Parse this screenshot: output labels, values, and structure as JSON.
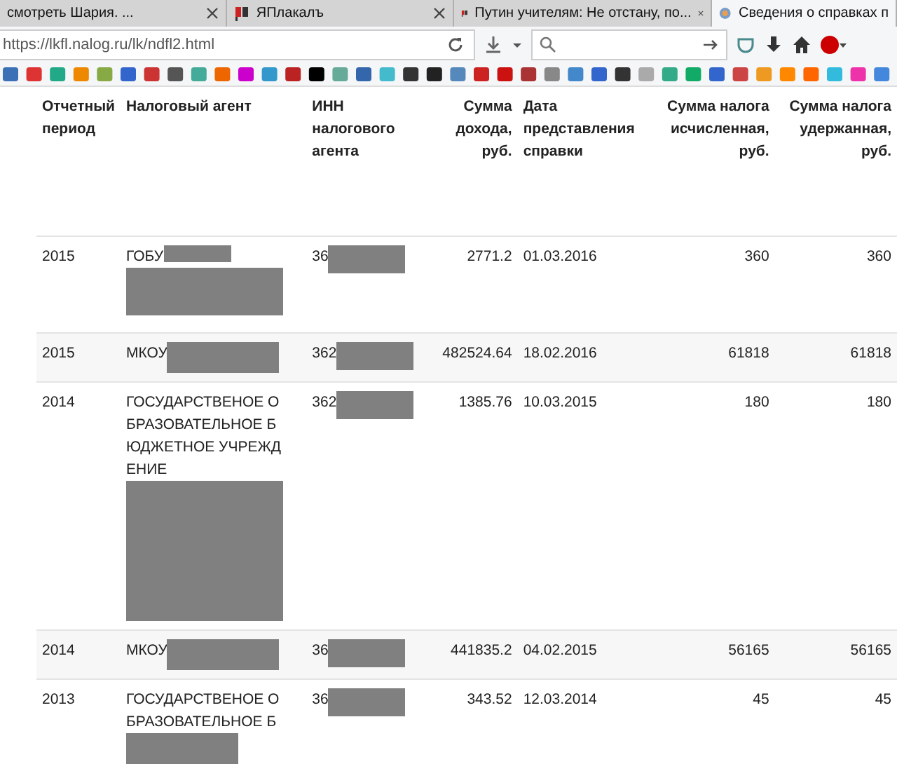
{
  "tabs": [
    {
      "title": "смотреть Шария. ...",
      "selected": false
    },
    {
      "title": "ЯПлакалъ",
      "selected": false
    },
    {
      "title": "Путин учителям: Не отстану, по...",
      "selected": false
    },
    {
      "title": "Сведения о справках п",
      "selected": true
    }
  ],
  "address_bar": {
    "url": "https://lkfl.nalog.ru/lk/ndfl2.html"
  },
  "table": {
    "columns": [
      "Отчетный период",
      "Налоговый агент",
      "ИНН налогового агента",
      "Сумма дохода, руб.",
      "Дата представления справки",
      "Сумма налога исчисленная, руб.",
      "Сумма налога удержанная, руб."
    ],
    "rows": [
      {
        "period": "2015",
        "agent_lines": [
          "ГОБУ"
        ],
        "inn": "36",
        "income": "2771.2",
        "date": "01.03.2016",
        "tax_calculated": "360",
        "tax_withheld": "360"
      },
      {
        "period": "2015",
        "agent_lines": [
          "МКОУ"
        ],
        "inn": "362",
        "income": "482524.64",
        "date": "18.02.2016",
        "tax_calculated": "61818",
        "tax_withheld": "61818"
      },
      {
        "period": "2014",
        "agent_lines": [
          "ГОСУДАРСТВЕНОЕ О",
          "БРАЗОВАТЕЛЬНОЕ Б",
          "ЮДЖЕТНОЕ УЧРЕЖД",
          "ЕНИЕ"
        ],
        "inn": "362",
        "income": "1385.76",
        "date": "10.03.2015",
        "tax_calculated": "180",
        "tax_withheld": "180"
      },
      {
        "period": "2014",
        "agent_lines": [
          "МКОУ"
        ],
        "inn": "36",
        "income": "441835.2",
        "date": "04.02.2015",
        "tax_calculated": "56165",
        "tax_withheld": "56165"
      },
      {
        "period": "2013",
        "agent_lines": [
          "ГОСУДАРСТВЕНОЕ О",
          "БРАЗОВАТЕЛЬНОЕ Б"
        ],
        "inn": "36",
        "income": "343.52",
        "date": "12.03.2014",
        "tax_calculated": "45",
        "tax_withheld": "45"
      }
    ]
  }
}
